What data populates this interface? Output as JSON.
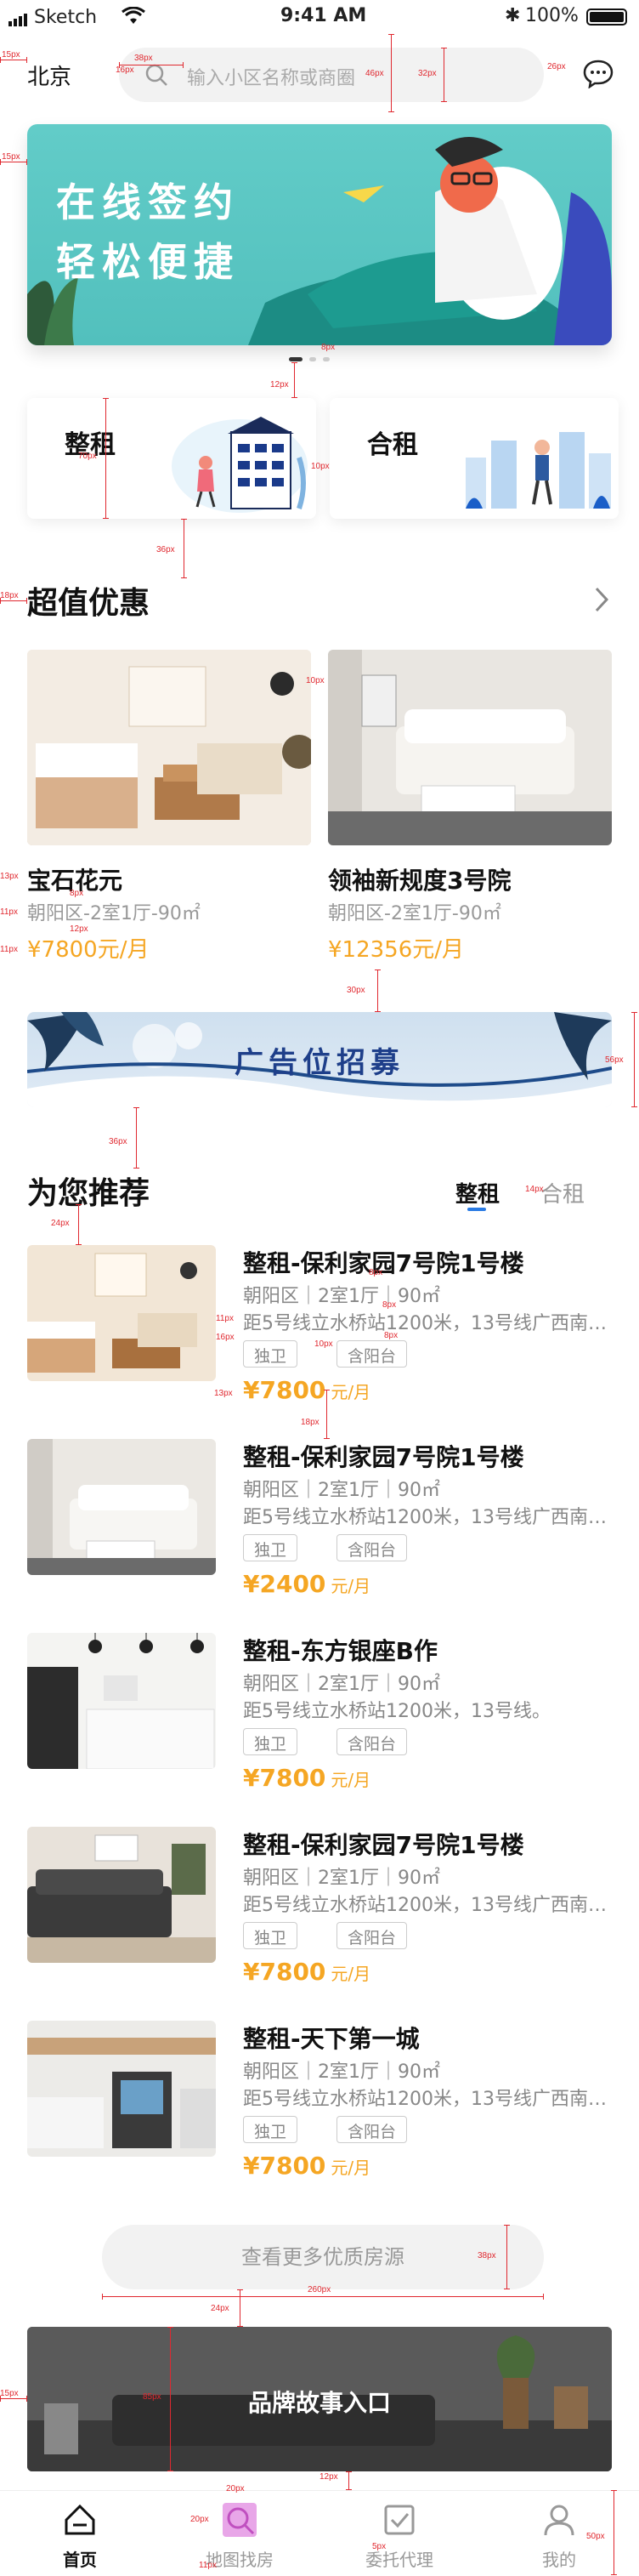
{
  "status_bar": {
    "carrier": "Sketch",
    "time": "9:41 AM",
    "battery": "100%"
  },
  "header": {
    "city": "北京",
    "search_placeholder": "输入小区名称或商圈",
    "message_icon": "chat-bubble-icon"
  },
  "banner": {
    "line1": "在线签约",
    "line2": "轻松便捷"
  },
  "quick_cards": [
    {
      "label": "整租"
    },
    {
      "label": "合租"
    }
  ],
  "deals_section": {
    "title": "超值优惠",
    "items": [
      {
        "name": "宝石花元",
        "sub": "朝阳区-2室1厅-90㎡",
        "price": "¥7800元/月"
      },
      {
        "name": "领袖新规度3号院",
        "sub": "朝阳区-2室1厅-90㎡",
        "price": "¥12356元/月"
      }
    ]
  },
  "ad": {
    "text": "广告位招募"
  },
  "recommend": {
    "title": "为您推荐",
    "tabs": [
      "整租",
      "合租"
    ],
    "items": [
      {
        "title": "整租-保利家园7号院1号楼",
        "sub": "朝阳区｜2室1厅｜90㎡",
        "sub2": "距5号线立水桥站1200米，13号线广西南合...",
        "tags": [
          "独卫",
          "含阳台"
        ],
        "price": "¥7800",
        "unit": "元/月"
      },
      {
        "title": "整租-保利家园7号院1号楼",
        "sub": "朝阳区｜2室1厅｜90㎡",
        "sub2": "距5号线立水桥站1200米，13号线广西南合...",
        "tags": [
          "独卫",
          "含阳台"
        ],
        "price": "¥2400",
        "unit": "元/月"
      },
      {
        "title": "整租-东方银座B作",
        "sub": "朝阳区｜2室1厅｜90㎡",
        "sub2": "距5号线立水桥站1200米，13号线。",
        "tags": [
          "独卫",
          "含阳台"
        ],
        "price": "¥7800",
        "unit": "元/月"
      },
      {
        "title": "整租-保利家园7号院1号楼",
        "sub": "朝阳区｜2室1厅｜90㎡",
        "sub2": "距5号线立水桥站1200米，13号线广西南合...",
        "tags": [
          "独卫",
          "含阳台"
        ],
        "price": "¥7800",
        "unit": "元/月"
      },
      {
        "title": "整租-天下第一城",
        "sub": "朝阳区｜2室1厅｜90㎡",
        "sub2": "距5号线立水桥站1200米，13号线广西南合...",
        "tags": [
          "独卫",
          "含阳台"
        ],
        "price": "¥7800",
        "unit": "元/月"
      }
    ],
    "more_button": "查看更多优质房源"
  },
  "brand": {
    "text": "品牌故事入口"
  },
  "tabbar": [
    {
      "label": "首页",
      "icon": "home-icon"
    },
    {
      "label": "地图找房",
      "icon": "map-search-icon"
    },
    {
      "label": "委托代理",
      "icon": "delegate-check-icon"
    },
    {
      "label": "我的",
      "icon": "profile-icon"
    }
  ],
  "annotations": {
    "a1": "15px",
    "a2": "38px",
    "a3": "16px",
    "a4": "46px",
    "a5": "32px",
    "a6": "26px",
    "a7": "15px",
    "a8": "8px",
    "a9": "12px",
    "a10": "70px",
    "a11": "10px",
    "a12": "36px",
    "a13": "18px",
    "a14": "10px",
    "a15": "13px",
    "a16": "8px",
    "a17": "11px",
    "a18": "12px",
    "a19": "11px",
    "a20": "30px",
    "a21": "56px",
    "a22": "36px",
    "a23": "24px",
    "a24": "14px",
    "a25": "8px",
    "a26": "11px",
    "a27": "8px",
    "a28": "16px",
    "a29": "10px",
    "a30": "8px",
    "a31": "13px",
    "a32": "18px",
    "a33": "38px",
    "a34": "260px",
    "a35": "24px",
    "a36": "15px",
    "a37": "85px",
    "a38": "12px",
    "a39": "20px",
    "a40": "20px",
    "a41": "5px",
    "a42": "11px",
    "a43": "50px"
  }
}
